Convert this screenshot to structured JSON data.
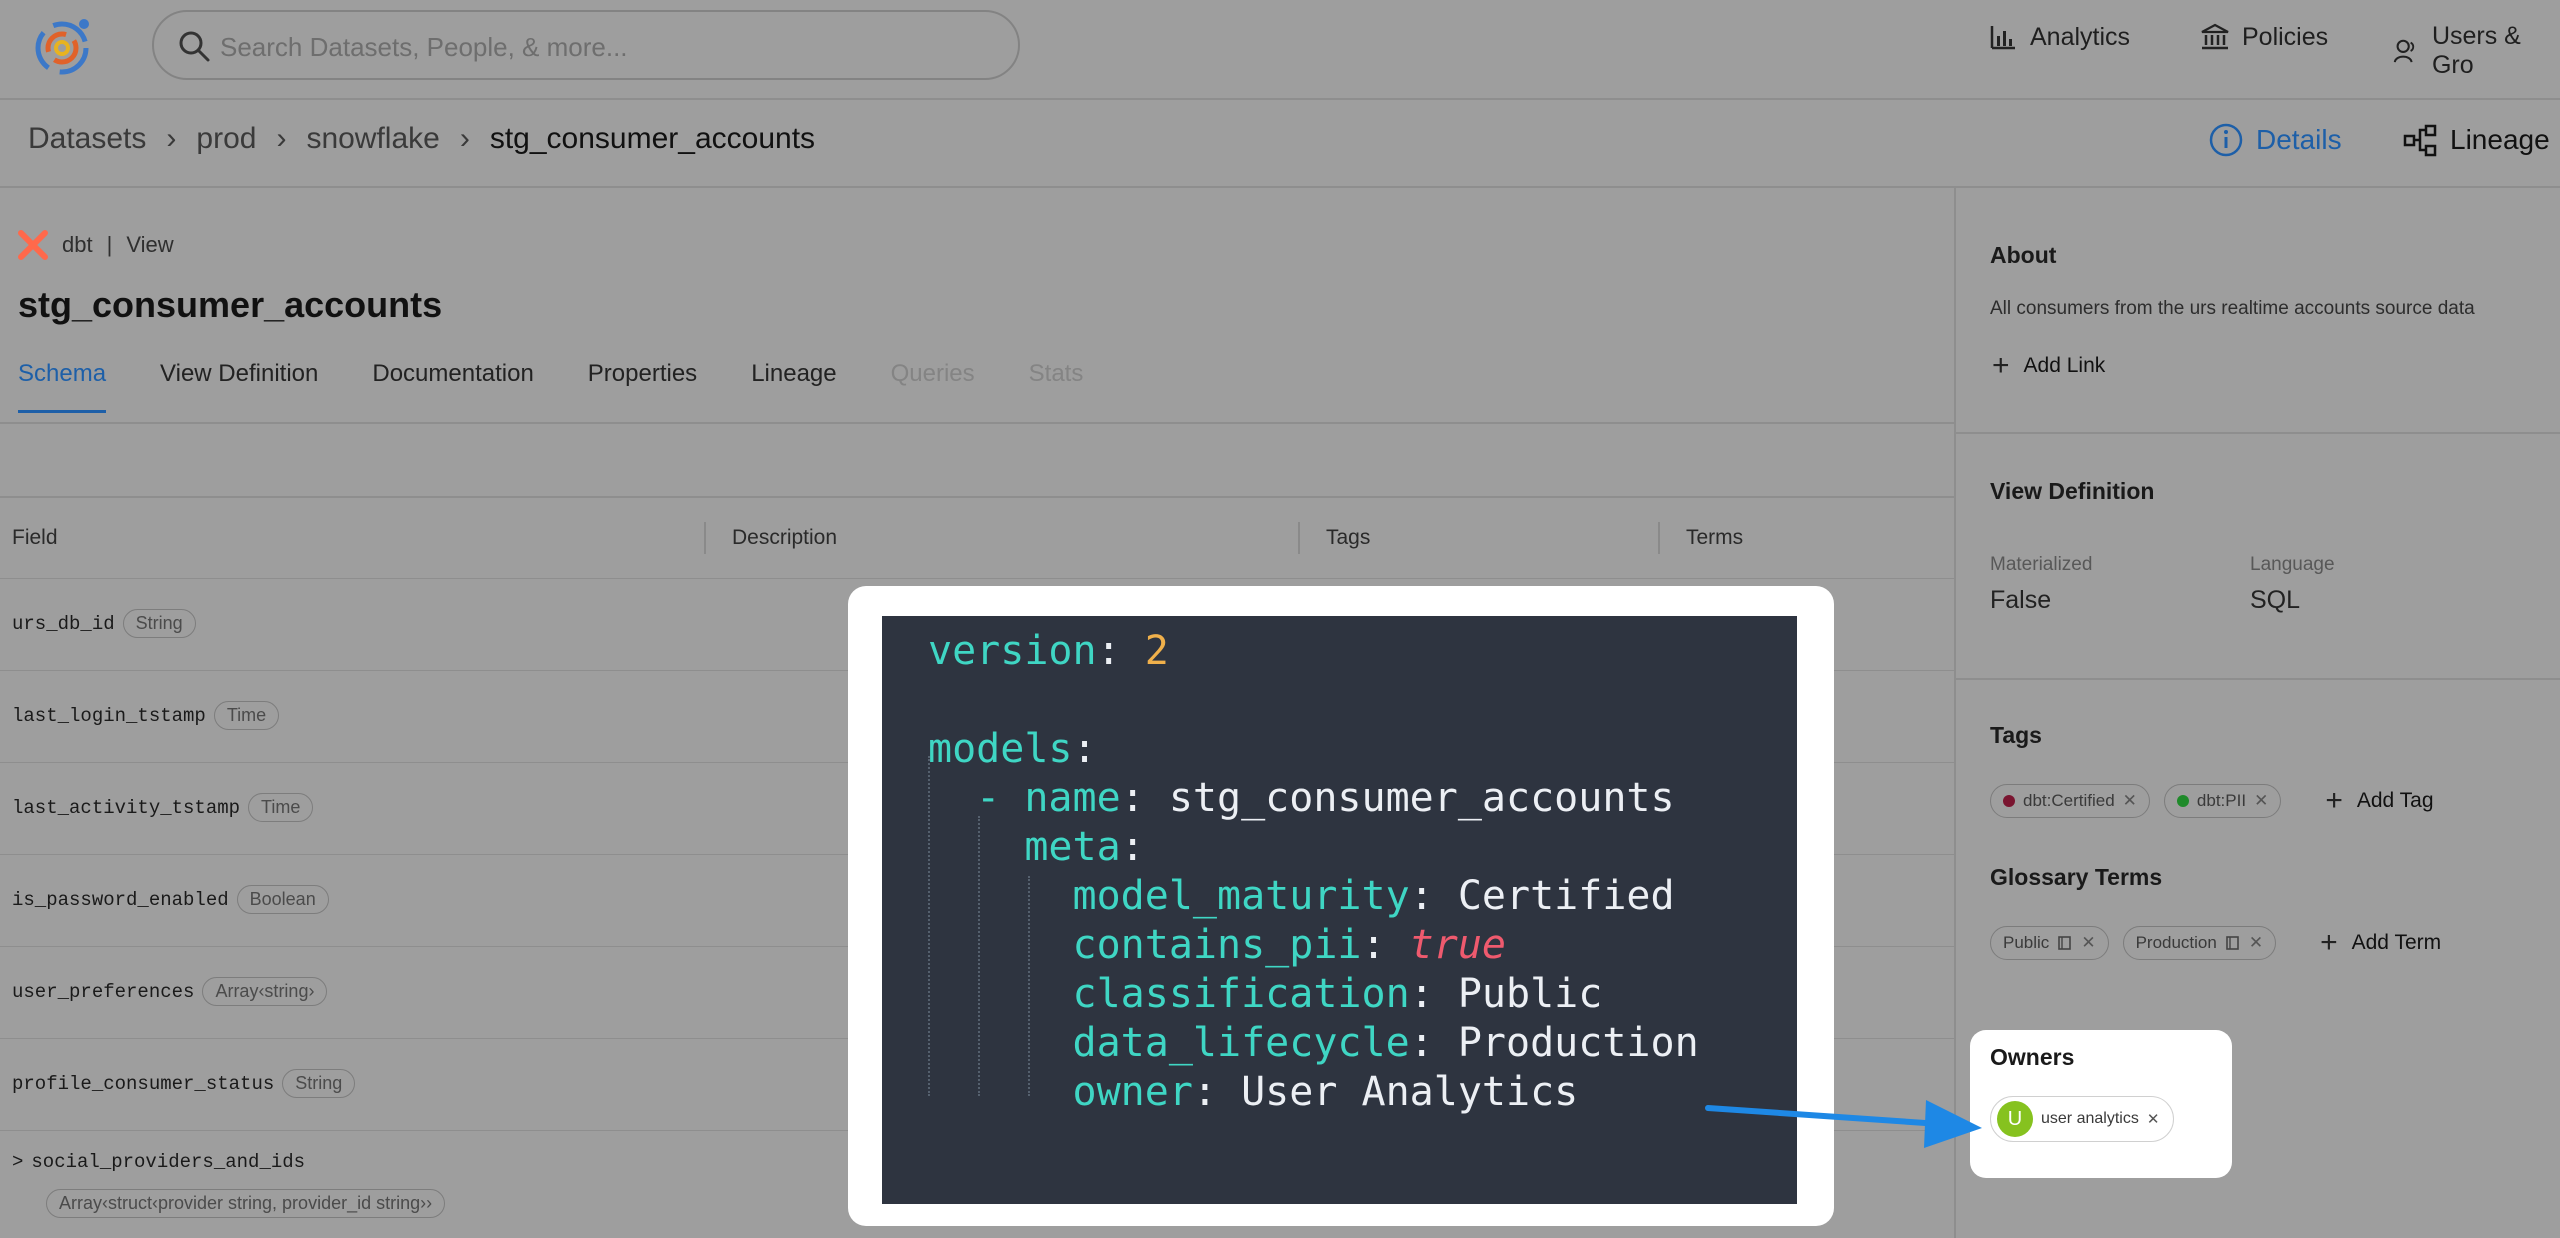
{
  "app": {
    "logo_icon": "datahub-logo-icon"
  },
  "search": {
    "placeholder": "Search Datasets, People, & more..."
  },
  "topnav": {
    "analytics": "Analytics",
    "policies": "Policies",
    "users": "Users & Gro"
  },
  "breadcrumb": {
    "items": [
      "Datasets",
      "prod",
      "snowflake"
    ],
    "current": "stg_consumer_accounts",
    "separator": "›"
  },
  "view_toggle": {
    "details": "Details",
    "lineage": "Lineage"
  },
  "entity": {
    "platform": "dbt",
    "divider": "|",
    "subtype": "View",
    "title": "stg_consumer_accounts"
  },
  "tabs": [
    {
      "label": "Schema",
      "state": "active"
    },
    {
      "label": "View Definition",
      "state": "normal"
    },
    {
      "label": "Documentation",
      "state": "normal"
    },
    {
      "label": "Properties",
      "state": "normal"
    },
    {
      "label": "Lineage",
      "state": "normal"
    },
    {
      "label": "Queries",
      "state": "disabled"
    },
    {
      "label": "Stats",
      "state": "disabled"
    }
  ],
  "schema_table": {
    "columns": [
      "Field",
      "Description",
      "Tags",
      "Terms"
    ],
    "rows": [
      {
        "field": "urs_db_id",
        "type": "String"
      },
      {
        "field": "last_login_tstamp",
        "type": "Time"
      },
      {
        "field": "last_activity_tstamp",
        "type": "Time"
      },
      {
        "field": "is_password_enabled",
        "type": "Boolean"
      },
      {
        "field": "user_preferences",
        "type": "Array‹string›"
      },
      {
        "field": "profile_consumer_status",
        "type": "String"
      },
      {
        "field": "social_providers_and_ids",
        "type": "Array‹struct‹provider string, provider_id string››",
        "expand": ">"
      }
    ]
  },
  "sidebar": {
    "about": {
      "title": "About",
      "text": "All consumers from the urs realtime accounts source data",
      "add_link": "Add Link"
    },
    "view_definition": {
      "title": "View Definition",
      "materialized_label": "Materialized",
      "materialized_value": "False",
      "language_label": "Language",
      "language_value": "SQL"
    },
    "tags": {
      "title": "Tags",
      "items": [
        {
          "label": "dbt:Certified",
          "color": "#7a1530"
        },
        {
          "label": "dbt:PII",
          "color": "#1f8a2a"
        }
      ],
      "add": "Add Tag"
    },
    "glossary": {
      "title": "Glossary Terms",
      "items": [
        {
          "label": "Public"
        },
        {
          "label": "Production"
        }
      ],
      "add": "Add Term"
    },
    "owners": {
      "title": "Owners",
      "owner_initial": "U",
      "owner_name": "user analytics",
      "avatar_color": "#86c21f"
    }
  },
  "code_callout": {
    "lines": [
      {
        "key": "version",
        "value": "2",
        "value_style": "number"
      },
      {
        "key": "models",
        "value": "",
        "value_style": "none"
      },
      {
        "prefix": "- ",
        "key": "name",
        "value": "stg_consumer_accounts",
        "value_style": "plain"
      },
      {
        "key": "meta",
        "value": "",
        "value_style": "none"
      },
      {
        "key": "model_maturity",
        "value": "Certified",
        "value_style": "plain"
      },
      {
        "key": "contains_pii",
        "value": "true",
        "value_style": "bool"
      },
      {
        "key": "classification",
        "value": "Public",
        "value_style": "plain"
      },
      {
        "key": "data_lifecycle",
        "value": "Production",
        "value_style": "plain"
      },
      {
        "key": "owner",
        "value": "User Analytics",
        "value_style": "plain"
      }
    ]
  },
  "colors": {
    "accent": "#1d5fa8",
    "code_bg": "#2e3440",
    "code_key": "#3fd6c4",
    "code_number": "#f0b04b",
    "code_bool": "#ef5a6e",
    "arrow": "#1e88e5"
  }
}
